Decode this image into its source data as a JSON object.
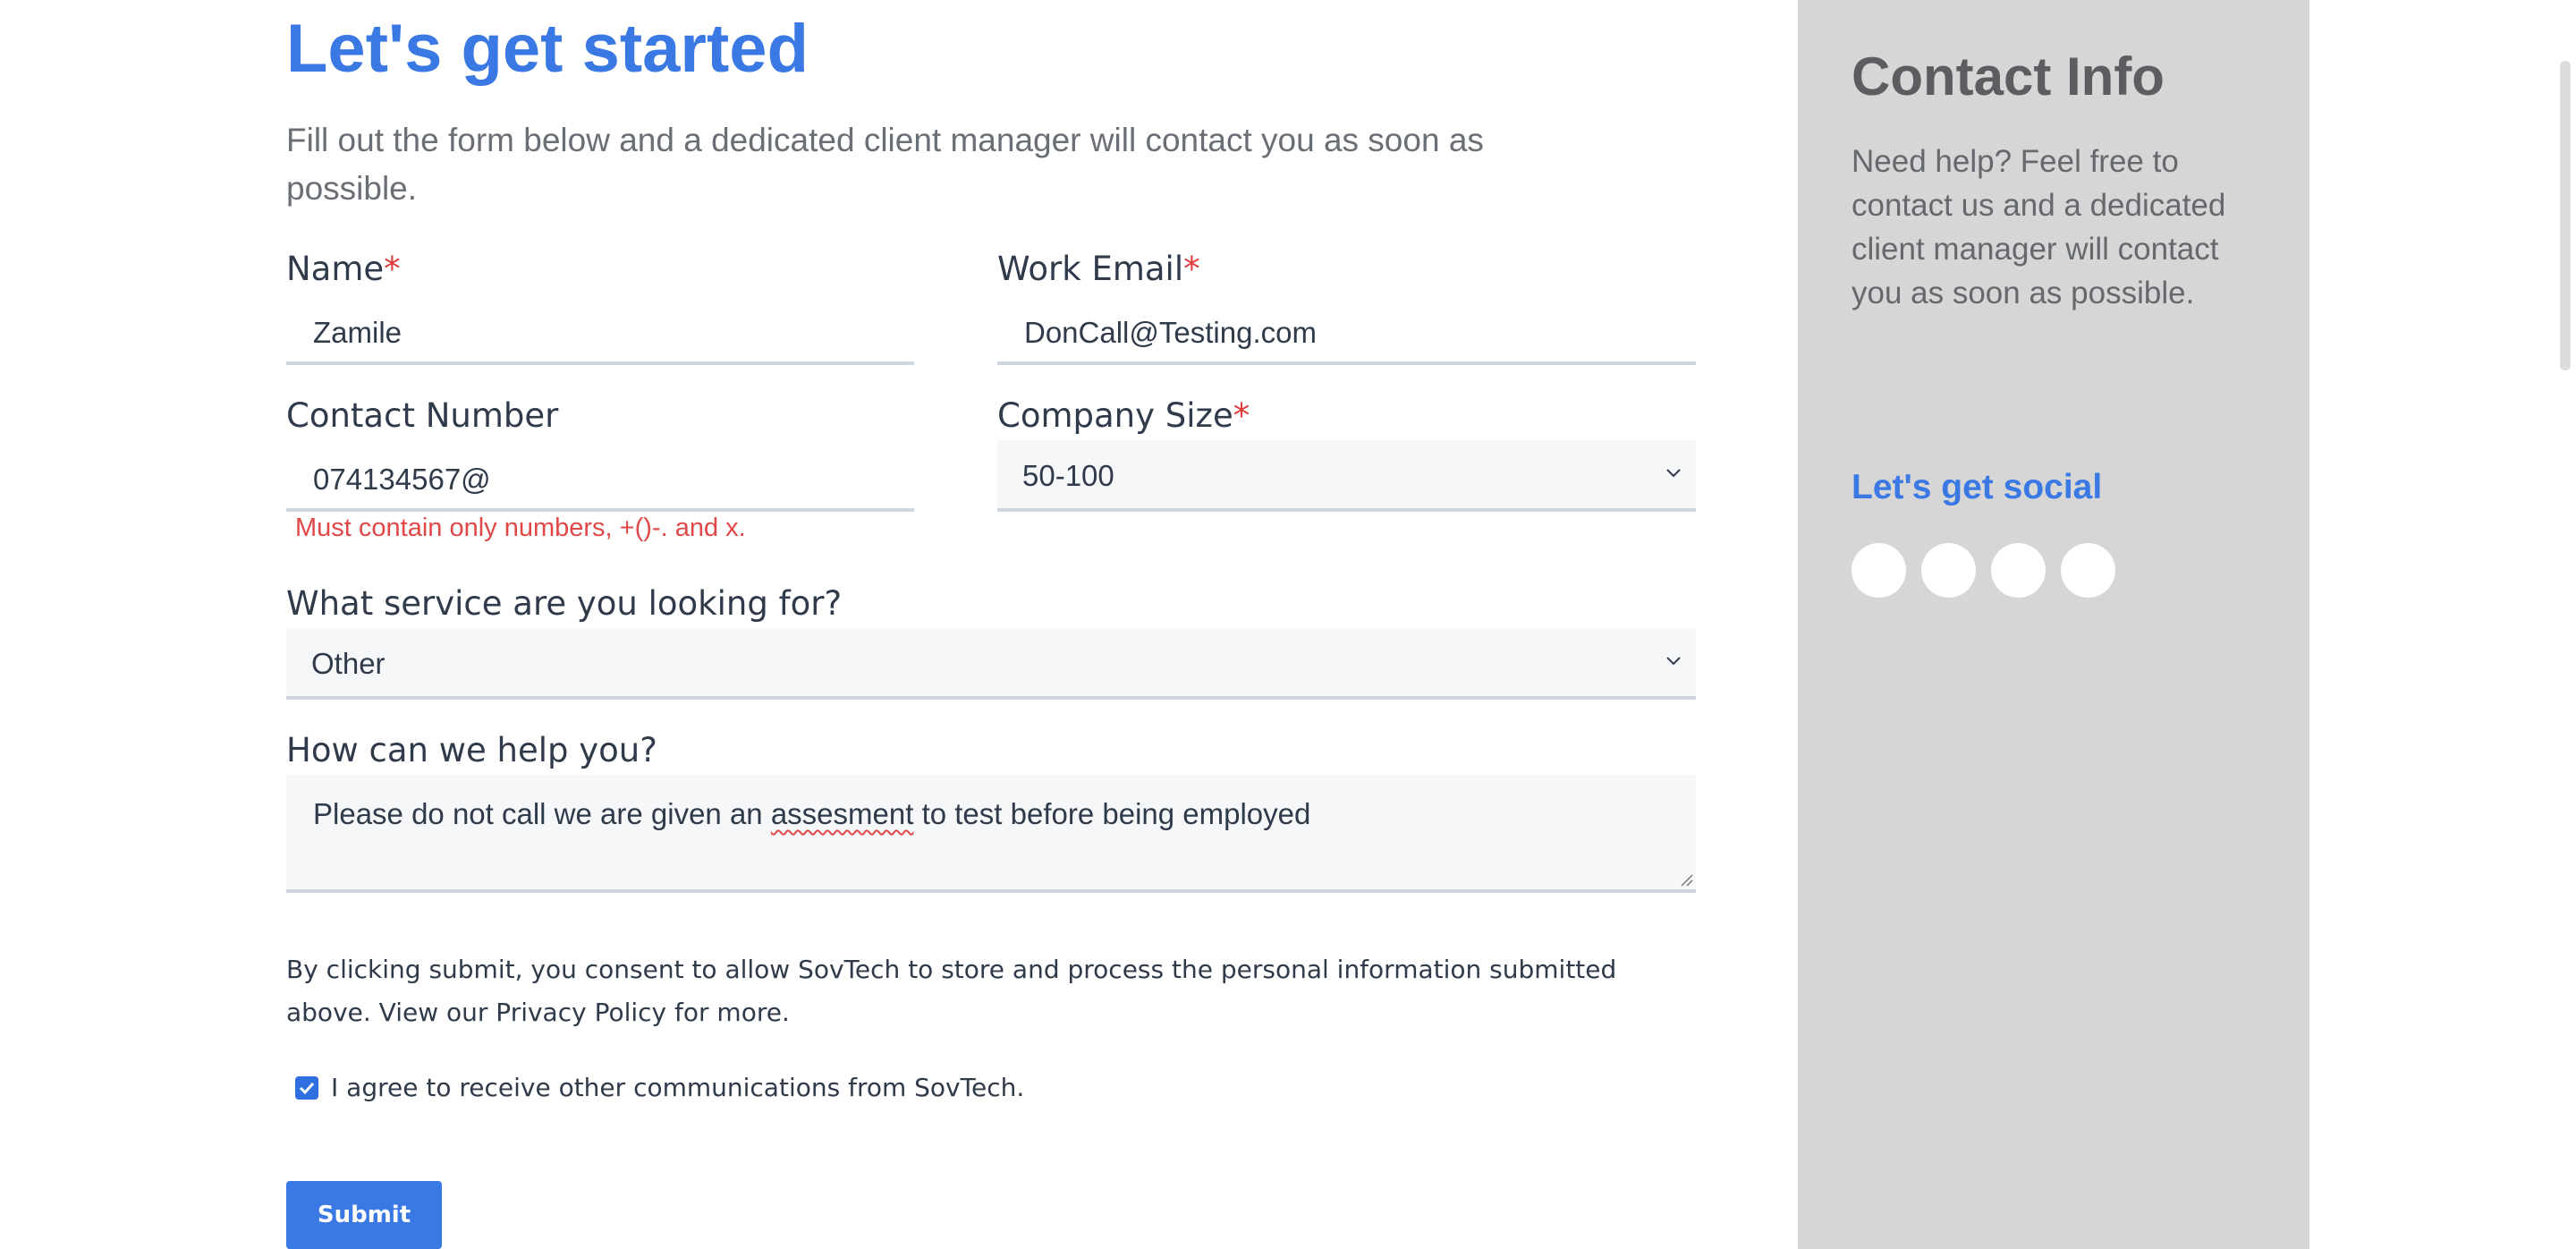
{
  "form": {
    "title": "Let's get started",
    "subtitle": "Fill out the form below and a dedicated client manager will contact you as soon as possible.",
    "name_label": "Name",
    "name_value": "Zamile",
    "email_label": "Work Email",
    "email_value": "DonCall@Testing.com",
    "contact_label": "Contact Number",
    "contact_value": "074134567@",
    "contact_error": "Must contain only numbers, +()-. and x.",
    "company_size_label": "Company Size",
    "company_size_value": "50-100",
    "service_label": "What service are you looking for?",
    "service_value": "Other",
    "help_label": "How can we help you?",
    "help_value_before": "Please do not call we are given an ",
    "help_value_misspelled": "assesment",
    "help_value_after": " to test before being employed",
    "required_marker": "*",
    "consent_text": "By clicking submit, you consent to allow SovTech to store and process the personal information submitted above. View our Privacy Policy for more.",
    "checkbox_label": "I agree to receive other communications from SovTech.",
    "checkbox_checked": true,
    "submit_label": "Submit"
  },
  "sidebar": {
    "title": "Contact Info",
    "text": "Need help? Feel free to contact us and a dedicated client manager will contact you as soon as possible.",
    "social_title": "Let's get social",
    "social_icons": [
      "social-icon-1",
      "social-icon-2",
      "social-icon-3",
      "social-icon-4"
    ]
  },
  "colors": {
    "accent": "#3a78e4",
    "error": "#e04848",
    "sidebar_bg": "#d6d6d6"
  }
}
